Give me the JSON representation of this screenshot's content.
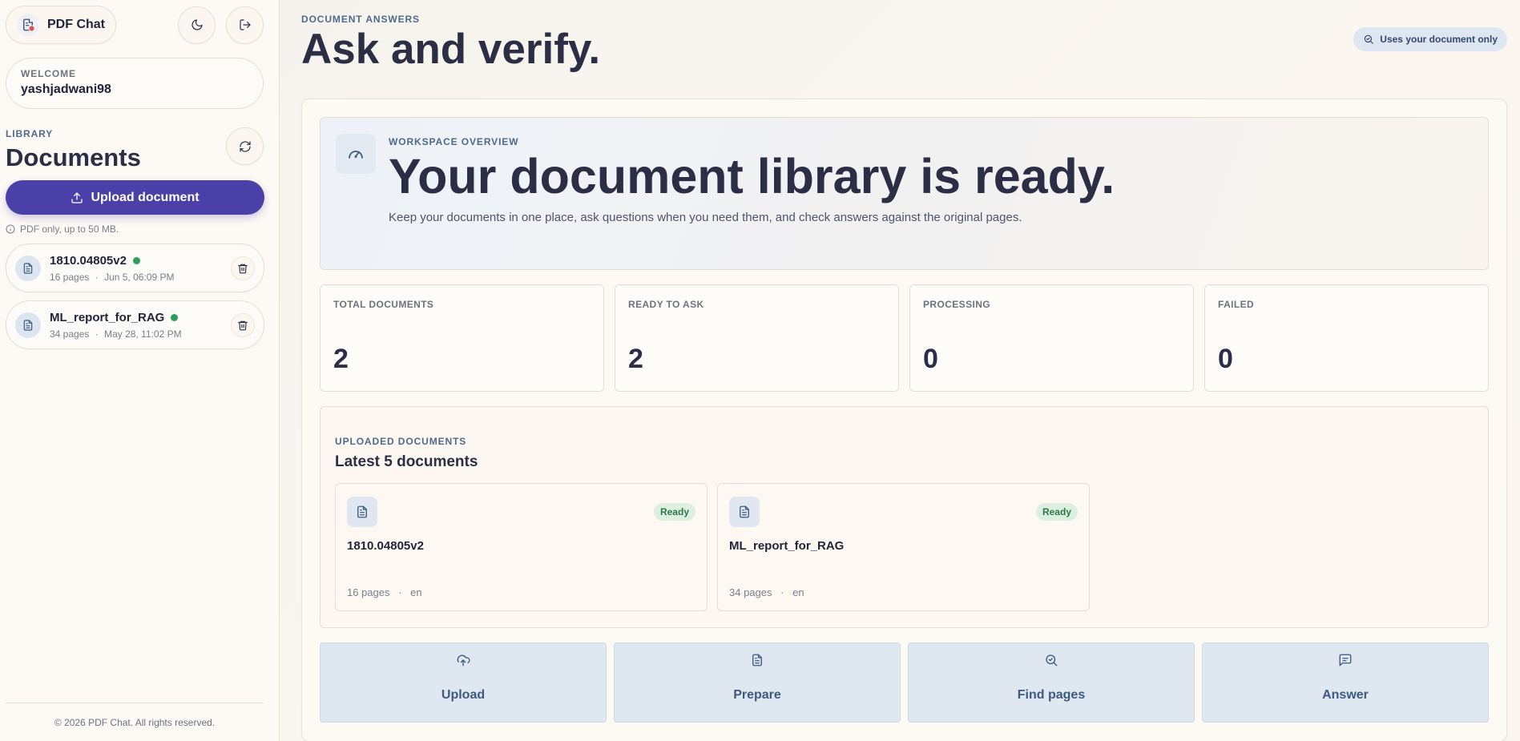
{
  "sidebar": {
    "brand": "PDF Chat",
    "welcome_label": "WELCOME",
    "username": "yashjadwani98",
    "library_label": "LIBRARY",
    "library_title": "Documents",
    "upload_label": "Upload document",
    "hint": "PDF only, up to 50 MB.",
    "documents": [
      {
        "name": "1810.04805v2",
        "pages": "16 pages",
        "date": "Jun 5, 06:09 PM"
      },
      {
        "name": "ML_report_for_RAG",
        "pages": "34 pages",
        "date": "May 28, 11:02 PM"
      }
    ],
    "meta_sep": "·",
    "footer": "© 2026 PDF Chat. All rights reserved."
  },
  "header": {
    "eyebrow": "DOCUMENT ANSWERS",
    "title": "Ask and verify.",
    "pill": "Uses your document only"
  },
  "overview": {
    "eyebrow": "WORKSPACE OVERVIEW",
    "title": "Your document library is ready.",
    "description": "Keep your documents in one place, ask questions when you need them, and check answers against the original pages."
  },
  "stats": [
    {
      "label": "TOTAL DOCUMENTS",
      "value": "2"
    },
    {
      "label": "READY TO ASK",
      "value": "2"
    },
    {
      "label": "PROCESSING",
      "value": "0"
    },
    {
      "label": "FAILED",
      "value": "0"
    }
  ],
  "uploaded": {
    "eyebrow": "UPLOADED DOCUMENTS",
    "title": "Latest 5 documents",
    "cards": [
      {
        "name": "1810.04805v2",
        "status": "Ready",
        "pages": "16 pages",
        "lang": "en"
      },
      {
        "name": "ML_report_for_RAG",
        "status": "Ready",
        "pages": "34 pages",
        "lang": "en"
      }
    ]
  },
  "steps": [
    {
      "label": "Upload",
      "icon": "cloud-upload-icon"
    },
    {
      "label": "Prepare",
      "icon": "document-icon"
    },
    {
      "label": "Find pages",
      "icon": "search-icon"
    },
    {
      "label": "Answer",
      "icon": "chat-icon"
    }
  ],
  "colors": {
    "accent": "#4b40a8",
    "ready_green": "#2f9e5a",
    "step_blue": "#dfe7f1"
  }
}
